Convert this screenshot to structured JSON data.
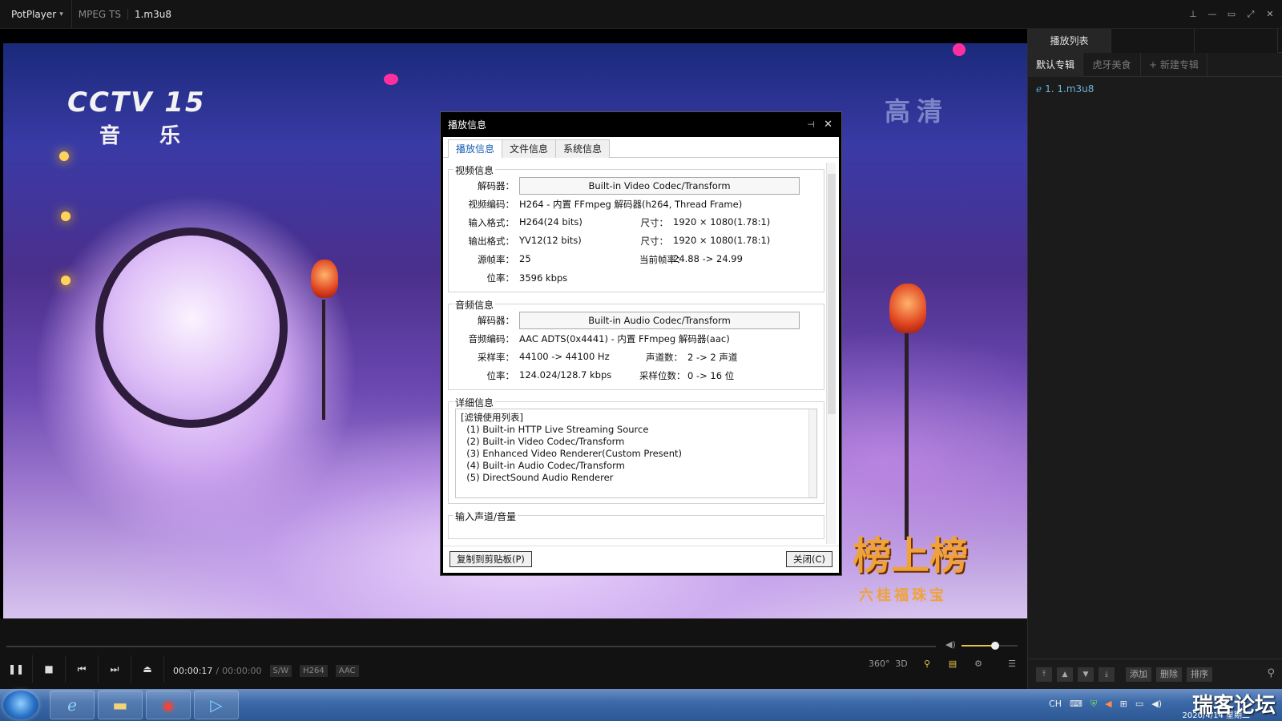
{
  "window": {
    "app_name": "PotPlayer",
    "format": "MPEG TS",
    "file_name": "1.m3u8"
  },
  "video": {
    "channel_logo": "CCTV 15",
    "channel_sub": "音 乐",
    "hd_mark": "高清",
    "brand": "榜上榜",
    "brand_sub": "六桂福珠宝"
  },
  "playlist": {
    "tab_label": "播放列表",
    "albums": [
      "默认专辑",
      "虎牙美食",
      "+ 新建专辑"
    ],
    "items": [
      {
        "label": "1. 1.m3u8"
      }
    ],
    "bottom_buttons": [
      "添加",
      "删除",
      "排序"
    ]
  },
  "controls": {
    "time_current": "00:00:17",
    "time_sep": "/",
    "time_total": "00:00:00",
    "badges": [
      "S/W",
      "H264",
      "AAC"
    ],
    "right_icons": [
      "360°",
      "3D"
    ],
    "volume": 0.6
  },
  "dialog": {
    "title": "播放信息",
    "tabs": [
      "播放信息",
      "文件信息",
      "系统信息"
    ],
    "video_group": {
      "title": "视频信息",
      "decoder_label": "解码器：",
      "decoder_value": "Built-in Video Codec/Transform",
      "codec_label": "视频编码：",
      "codec_value": "H264 - 内置 FFmpeg 解码器(h264, Thread Frame)",
      "input_format_label": "输入格式：",
      "input_format_value": "H264(24 bits)",
      "size_label": "尺寸：",
      "input_size_value": "1920 × 1080(1.78:1)",
      "output_format_label": "输出格式：",
      "output_format_value": "YV12(12 bits)",
      "output_size_value": "1920 × 1080(1.78:1)",
      "src_fps_label": "源帧率：",
      "src_fps_value": "25",
      "cur_fps_label": "当前帧率：",
      "cur_fps_value": "24.88 -> 24.99",
      "bitrate_label": "位率：",
      "bitrate_value": "3596 kbps"
    },
    "audio_group": {
      "title": "音频信息",
      "decoder_label": "解码器：",
      "decoder_value": "Built-in Audio Codec/Transform",
      "codec_label": "音频编码：",
      "codec_value": "AAC ADTS(0x4441) - 内置 FFmpeg 解码器(aac)",
      "samplerate_label": "采样率：",
      "samplerate_value": "44100 -> 44100 Hz",
      "channels_label": "声道数：",
      "channels_value": "2 -> 2 声道",
      "bitrate_label": "位率：",
      "bitrate_value": "124.024/128.7 kbps",
      "bits_label": "采样位数：",
      "bits_value": "0 -> 16 位"
    },
    "detail_group": {
      "title": "详细信息",
      "lines": [
        "[滤镜使用列表]",
        "  (1) Built-in HTTP Live Streaming Source",
        "  (2) Built-in Video Codec/Transform",
        "  (3) Enhanced Video Renderer(Custom Present)",
        "  (4) Built-in Audio Codec/Transform",
        "  (5) DirectSound Audio Renderer"
      ]
    },
    "input_group_title": "输入声道/音量",
    "copy_button": "复制到剪贴板(P)",
    "close_button": "关闭(C)"
  },
  "taskbar": {
    "tray_lang": "CH",
    "watermark": "瑞客论坛",
    "clock": "2020/4/14 星期二"
  }
}
